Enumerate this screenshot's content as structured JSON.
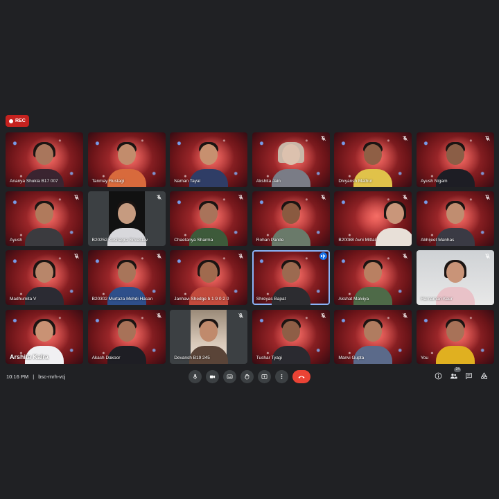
{
  "recording": {
    "label": "REC"
  },
  "participants": [
    {
      "name": "Ananya Shukla B17 007",
      "bg": "space"
    },
    {
      "name": "Tanmay Rustagi",
      "bg": "space"
    },
    {
      "name": "Naman Tayal",
      "bg": "space"
    },
    {
      "name": "Akshita Jain",
      "bg": "space"
    },
    {
      "name": "Divyansh Mathur",
      "bg": "space"
    },
    {
      "name": "Ayush Nigam",
      "bg": "space"
    },
    {
      "name": "Ayush",
      "bg": "space"
    },
    {
      "name": "B20252 Kushagra Srivastav",
      "bg": "gray"
    },
    {
      "name": "Chaetanya Sharma",
      "bg": "space"
    },
    {
      "name": "Rohan Pande",
      "bg": "space"
    },
    {
      "name": "B20088 Avni Mittal",
      "bg": "space"
    },
    {
      "name": "Abhijeet Manhas",
      "bg": "space"
    },
    {
      "name": "Madhumita V",
      "bg": "space"
    },
    {
      "name": "B20302 Murtaza Mehdi Hasan",
      "bg": "space"
    },
    {
      "name": "Janhavi Shedge b 1 9 0 2 0",
      "bg": "space"
    },
    {
      "name": "Shreyas Bapat",
      "bg": "space"
    },
    {
      "name": "Akshat Malviya",
      "bg": "space"
    },
    {
      "name": "Harnaman Kaur",
      "bg": "light"
    },
    {
      "name": "Arshita Kalra",
      "bg": "space"
    },
    {
      "name": "Akash Dakoor",
      "bg": "space"
    },
    {
      "name": "Devansh B19 245",
      "bg": "gray"
    },
    {
      "name": "Tushar Tyagi",
      "bg": "space"
    },
    {
      "name": "Manvi Gupta",
      "bg": "space"
    },
    {
      "name": "You",
      "bg": "space"
    }
  ],
  "bottom_bar": {
    "time": "10:16 PM",
    "separator": "|",
    "meeting_code": "bsc-rnrh-vcj",
    "participant_count": "24"
  },
  "colors": {
    "background": "#202124",
    "end_call": "#ea4335",
    "active_speaker": "#8ab4f8",
    "rec": "#c5221f"
  }
}
